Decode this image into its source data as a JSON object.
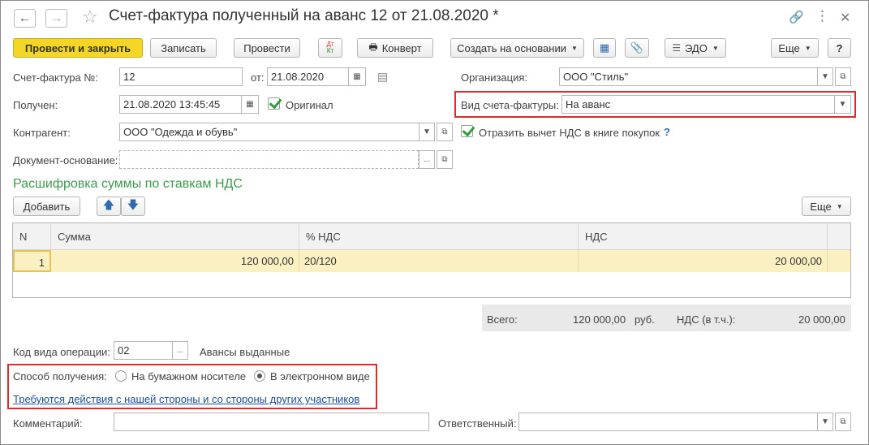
{
  "header": {
    "title": "Счет-фактура полученный на аванс 12 от 21.08.2020 *"
  },
  "toolbar": {
    "post_close": "Провести и закрыть",
    "save": "Записать",
    "post": "Провести",
    "dt_kt_top": "Дт",
    "dt_kt_bottom": "Кт",
    "envelope": "Конверт",
    "create_based": "Создать на основании",
    "edo": "ЭДО",
    "more": "Еще",
    "help": "?"
  },
  "form": {
    "invoice_no_label": "Счет-фактура №:",
    "invoice_no": "12",
    "date_label": "от:",
    "date": "21.08.2020",
    "org_label": "Организация:",
    "org": "ООО \"Стиль\"",
    "received_label": "Получен:",
    "received": "21.08.2020 13:45:45",
    "original_label": "Оригинал",
    "invoice_kind_label": "Вид счета-фактуры:",
    "invoice_kind": "На аванс",
    "counterparty_label": "Контрагент:",
    "counterparty": "ООО \"Одежда и обувь\"",
    "vat_deduction_label": "Отразить вычет НДС в книге покупок",
    "help_mark": "?",
    "base_doc_label": "Документ-основание:",
    "base_doc": "",
    "ellipsis": "..."
  },
  "section": {
    "title": "Расшифровка суммы по ставкам НДС",
    "add": "Добавить",
    "more": "Еще"
  },
  "table": {
    "columns": [
      "N",
      "Сумма",
      "% НДС",
      "НДС"
    ],
    "rows": [
      {
        "n": "1",
        "sum": "120 000,00",
        "rate": "20/120",
        "vat": "20 000,00"
      }
    ]
  },
  "totals": {
    "total_label": "Всего:",
    "total": "120 000,00",
    "currency": "руб.",
    "vat_label": "НДС (в т.ч.):",
    "vat": "20 000,00"
  },
  "operation": {
    "label": "Код вида операции:",
    "code": "02",
    "description": "Авансы выданные"
  },
  "receipt": {
    "label": "Способ получения:",
    "paper": "На бумажном носителе",
    "electronic": "В электронном виде",
    "selected": "electronic",
    "action_link": "Требуются действия с нашей стороны и со стороны других участников"
  },
  "footer": {
    "comment_label": "Комментарий:",
    "comment": "",
    "responsible_label": "Ответственный:",
    "responsible": ""
  },
  "colors": {
    "primary_button": "#f4d726",
    "section_title": "#3d9a4e",
    "highlight_box": "#e02a2a",
    "selected_row": "#fbf0c2",
    "link": "#1a4f9e"
  }
}
